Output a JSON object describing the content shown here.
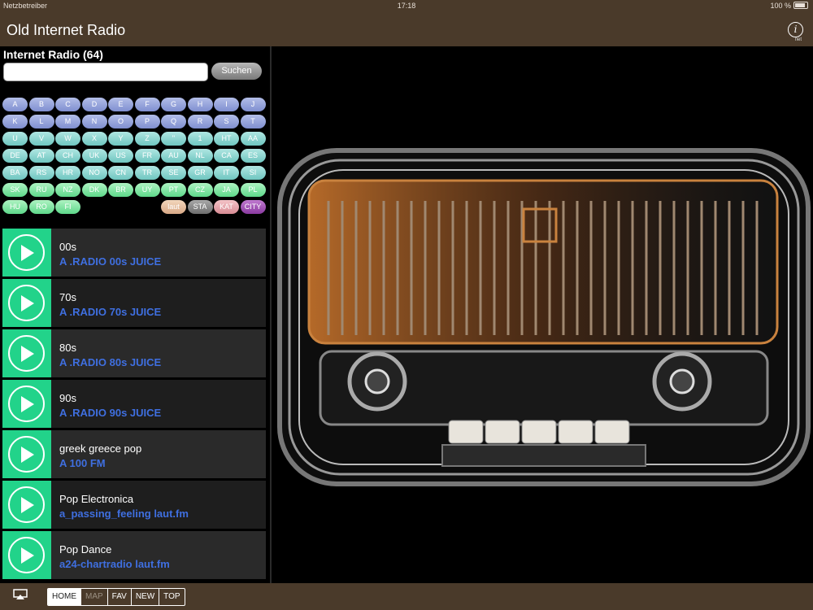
{
  "status_bar": {
    "carrier": "Netzbetreiber",
    "time": "17:18",
    "battery": "100 %"
  },
  "nav": {
    "title": "Old Internet Radio",
    "info_label": "net"
  },
  "panel": {
    "heading": "Internet Radio (64)",
    "search_placeholder": "",
    "search_button": "Suchen"
  },
  "keys": [
    [
      "A",
      "B",
      "C",
      "D",
      "E",
      "F",
      "G",
      "H",
      "I",
      "J"
    ],
    [
      "K",
      "L",
      "M",
      "N",
      "O",
      "P",
      "Q",
      "R",
      "S",
      "T"
    ],
    [
      "U",
      "V",
      "W",
      "X",
      "Y",
      "Z",
      "\"",
      "1",
      "HT",
      "AA"
    ],
    [
      "DE",
      "AT",
      "CH",
      "UK",
      "US",
      "FR",
      "AU",
      "NL",
      "CA",
      "ES"
    ],
    [
      "BA",
      "RS",
      "HR",
      "NO",
      "CN",
      "TR",
      "SE",
      "GR",
      "IT",
      "SI"
    ],
    [
      "SK",
      "RU",
      "NZ",
      "DK",
      "BR",
      "UY",
      "PT",
      "CZ",
      "JA",
      "PL"
    ],
    [
      "HU",
      "RO",
      "FI",
      "",
      "",
      "",
      "laut",
      "STA",
      "KAT",
      "CITY"
    ]
  ],
  "stations": [
    {
      "genre": "00s",
      "name": "A .RADIO 00s JUICE"
    },
    {
      "genre": "70s",
      "name": "A .RADIO 70s JUICE"
    },
    {
      "genre": "80s",
      "name": "A .RADIO 80s JUICE"
    },
    {
      "genre": "90s",
      "name": "A .RADIO 90s JUICE"
    },
    {
      "genre": "greek greece pop",
      "name": "A 100 FM"
    },
    {
      "genre": "Pop Electronica",
      "name": "a_passing_feeling laut.fm"
    },
    {
      "genre": "Pop Dance",
      "name": "a24-chartradio laut.fm"
    }
  ],
  "tabs": [
    {
      "label": "HOME",
      "state": "active"
    },
    {
      "label": "MAP",
      "state": "disabled"
    },
    {
      "label": "FAV",
      "state": "normal"
    },
    {
      "label": "NEW",
      "state": "normal"
    },
    {
      "label": "TOP",
      "state": "normal"
    }
  ],
  "colors": {
    "bar": "#4a3a2a",
    "play_green": "#22d38a",
    "station_blue": "#3f6fe0"
  },
  "icons": {
    "info": "info-icon",
    "airplay": "screen-mirror-icon",
    "play": "play-icon"
  }
}
